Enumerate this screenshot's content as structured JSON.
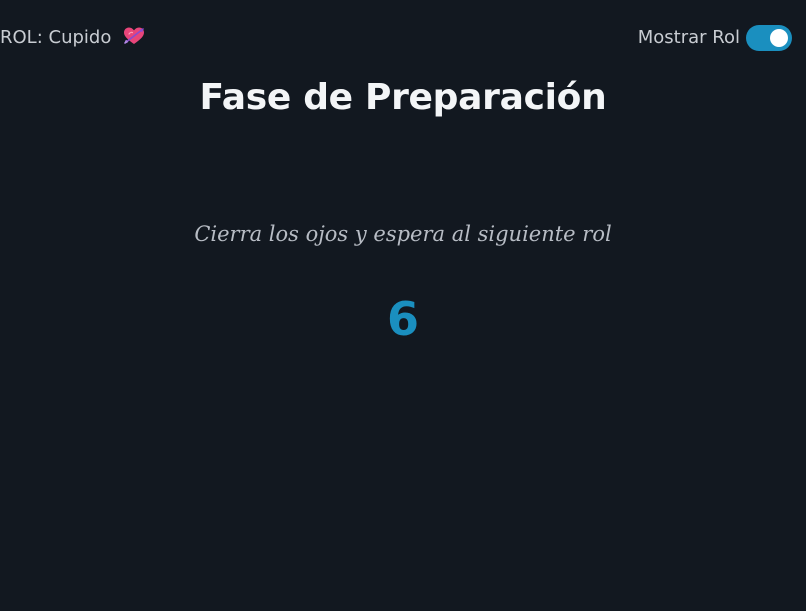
{
  "header": {
    "role_prefix": "ROL: ",
    "role_name": "Cupido",
    "role_icon": "heart-with-arrow-icon",
    "toggle_label": "Mostrar Rol",
    "toggle_on": true
  },
  "main": {
    "title": "Fase de Preparación",
    "instruction": "Cierra los ojos y espera al siguiente rol",
    "countdown": "6"
  },
  "colors": {
    "background": "#121820",
    "accent": "#1a8fbf",
    "heart": "#e8457a"
  }
}
